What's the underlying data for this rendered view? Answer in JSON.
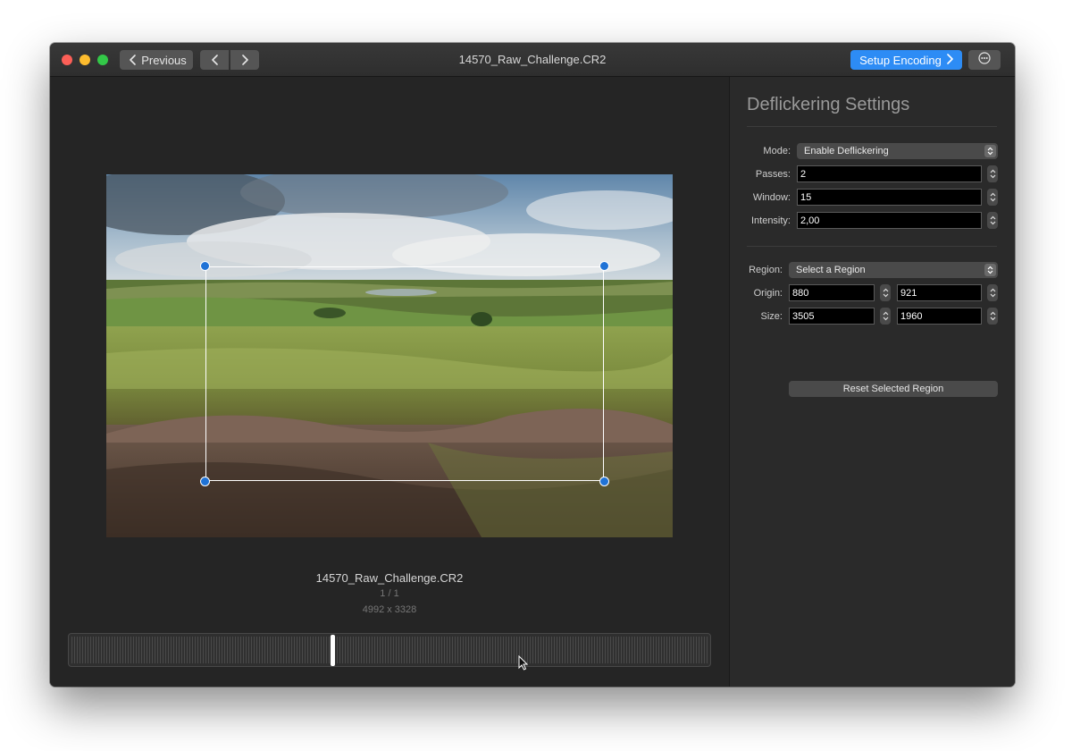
{
  "window": {
    "title": "14570_Raw_Challenge.CR2",
    "previous_label": "Previous",
    "encode_label": "Setup Encoding",
    "accent_color": "#2d8cf5"
  },
  "preview": {
    "file_name": "14570_Raw_Challenge.CR2",
    "frame_counter": "1 / 1",
    "dimensions": "4992 x 3328",
    "timeline_position": 0.41
  },
  "settings": {
    "title": "Deflickering Settings",
    "mode_label": "Mode:",
    "mode_value": "Enable Deflickering",
    "passes_label": "Passes:",
    "passes_value": "2",
    "window_label": "Window:",
    "window_value": "15",
    "intensity_label": "Intensity:",
    "intensity_value": "2,00",
    "region_label": "Region:",
    "region_value": "Select a Region",
    "origin_label": "Origin:",
    "origin_x": "880",
    "origin_y": "921",
    "size_label": "Size:",
    "size_w": "3505",
    "size_h": "1960",
    "reset_label": "Reset Selected Region"
  },
  "icons": {
    "previous": "chevron-left-icon",
    "back": "chevron-left-icon",
    "forward": "chevron-right-icon",
    "encode": "chevron-right-icon",
    "more": "ellipsis-circle-icon",
    "cursor": "mouse-pointer-icon"
  }
}
